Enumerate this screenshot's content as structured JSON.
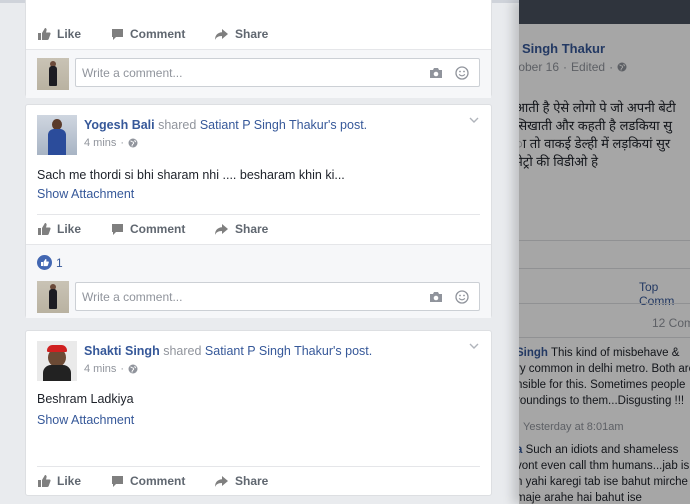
{
  "actions": {
    "like": "Like",
    "comment": "Comment",
    "share": "Share"
  },
  "comment_placeholder": "Write a comment...",
  "posts": [
    {
      "author": "Yogesh Bali",
      "verb": "shared",
      "source": "Satiant P Singh Thakur",
      "suffix": "'s post.",
      "time": "4 mins",
      "text": "Sach me thordi si bhi sharam nhi .... besharam khin ki...",
      "attachment": "Show Attachment",
      "reactions": "1"
    },
    {
      "author": "Shakti Singh",
      "verb": "shared",
      "source": "Satiant P Singh Thakur",
      "suffix": "'s post.",
      "time": "4 mins",
      "text": "Beshram Ladkiya",
      "attachment": "Show Attachment"
    }
  ],
  "viewer": {
    "author": "Singh Thakur",
    "date": "tober 16",
    "edited": "Edited",
    "body": [
      "आती है ऐसे लोगो पे जो अपनी बेटी",
      "सिखाती और कहती है लडकिया सु",
      "ा तो वाकई डेल्ही में लड़कियां सुर",
      "मेट्रो की विडीओ हे"
    ],
    "top_comments": "Top Comm",
    "comment_count": "12 Com",
    "comments": [
      {
        "name": "Singh",
        "lines": [
          "This kind of misbehave &",
          "ry common in delhi metro. Both are",
          "nsible for this. Sometimes people",
          "roundings to them...Disgusting !!!"
        ]
      },
      {
        "name": "a",
        "lines": [
          "Such an idiots and shameless",
          "vont even call thm humans...jab is",
          "n yahi karegi tab ise bahut mirche",
          "maje arahe hai bahut ise"
        ]
      }
    ],
    "comment_time": "Yesterday at 8:01am"
  }
}
